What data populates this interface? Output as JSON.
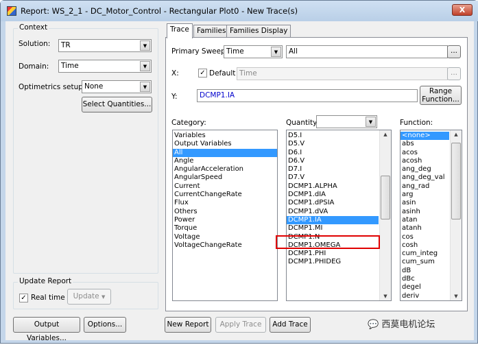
{
  "window": {
    "title": "Report: WS_2_1 - DC_Motor_Control - Rectangular Plot0 - New Trace(s)",
    "close_label": "X"
  },
  "context": {
    "group_label": "Context",
    "solution_label": "Solution:",
    "solution_value": "TR",
    "domain_label": "Domain:",
    "domain_value": "Time",
    "optimetrics_label": "Optimetrics setup:",
    "optimetrics_value": "None",
    "select_quantities_button": "Select Quantities..."
  },
  "update_report": {
    "group_label": "Update Report",
    "realtime_label": "Real time",
    "realtime_checked": true,
    "update_button": "Update"
  },
  "bottom": {
    "output_variables_button": "Output Variables...",
    "options_button": "Options...",
    "new_report_button": "New Report",
    "apply_trace_button": "Apply Trace",
    "add_trace_button": "Add Trace"
  },
  "tabs": [
    {
      "label": "Trace",
      "active": true
    },
    {
      "label": "Families"
    },
    {
      "label": "Families Display"
    }
  ],
  "trace": {
    "primary_sweep_label": "Primary Sweep:",
    "primary_sweep_value": "Time",
    "sweep_values": "All",
    "ellipsis": "...",
    "x_label": "X:",
    "default_label": "Default",
    "default_checked": true,
    "x_value": "Time",
    "y_label": "Y:",
    "y_value": "DCMP1.IA",
    "range_function_button_line1": "Range",
    "range_function_button_line2": "Function..."
  },
  "category": {
    "label": "Category:",
    "items": [
      "Variables",
      "Output Variables",
      "All",
      "Angle",
      "AngularAcceleration",
      "AngularSpeed",
      "Current",
      "CurrentChangeRate",
      "Flux",
      "Others",
      "Power",
      "Torque",
      "Voltage",
      "VoltageChangeRate"
    ],
    "selected": "All"
  },
  "quantity": {
    "label": "Quantity:",
    "filter_value": "",
    "items": [
      "D5.I",
      "D5.V",
      "D6.I",
      "D6.V",
      "D7.I",
      "D7.V",
      "DCMP1.ALPHA",
      "DCMP1.dIA",
      "DCMP1.dPSIA",
      "DCMP1.dVA",
      "DCMP1.IA",
      "DCMP1.MI",
      "DCMP1.N",
      "DCMP1.OMEGA",
      "DCMP1.PHI",
      "DCMP1.PHIDEG"
    ],
    "selected": "DCMP1.IA"
  },
  "function": {
    "label": "Function:",
    "items": [
      "<none>",
      "abs",
      "acos",
      "acosh",
      "ang_deg",
      "ang_deg_val",
      "ang_rad",
      "arg",
      "asin",
      "asinh",
      "atan",
      "atanh",
      "cos",
      "cosh",
      "cum_integ",
      "cum_sum",
      "dB",
      "dBc",
      "degel",
      "deriv"
    ],
    "selected": "<none>"
  },
  "watermark": {
    "text": "西莫电机论坛"
  },
  "colors": {
    "selection": "#3399ff",
    "highlight_box": "#e00000",
    "y_text": "#0000cc"
  }
}
